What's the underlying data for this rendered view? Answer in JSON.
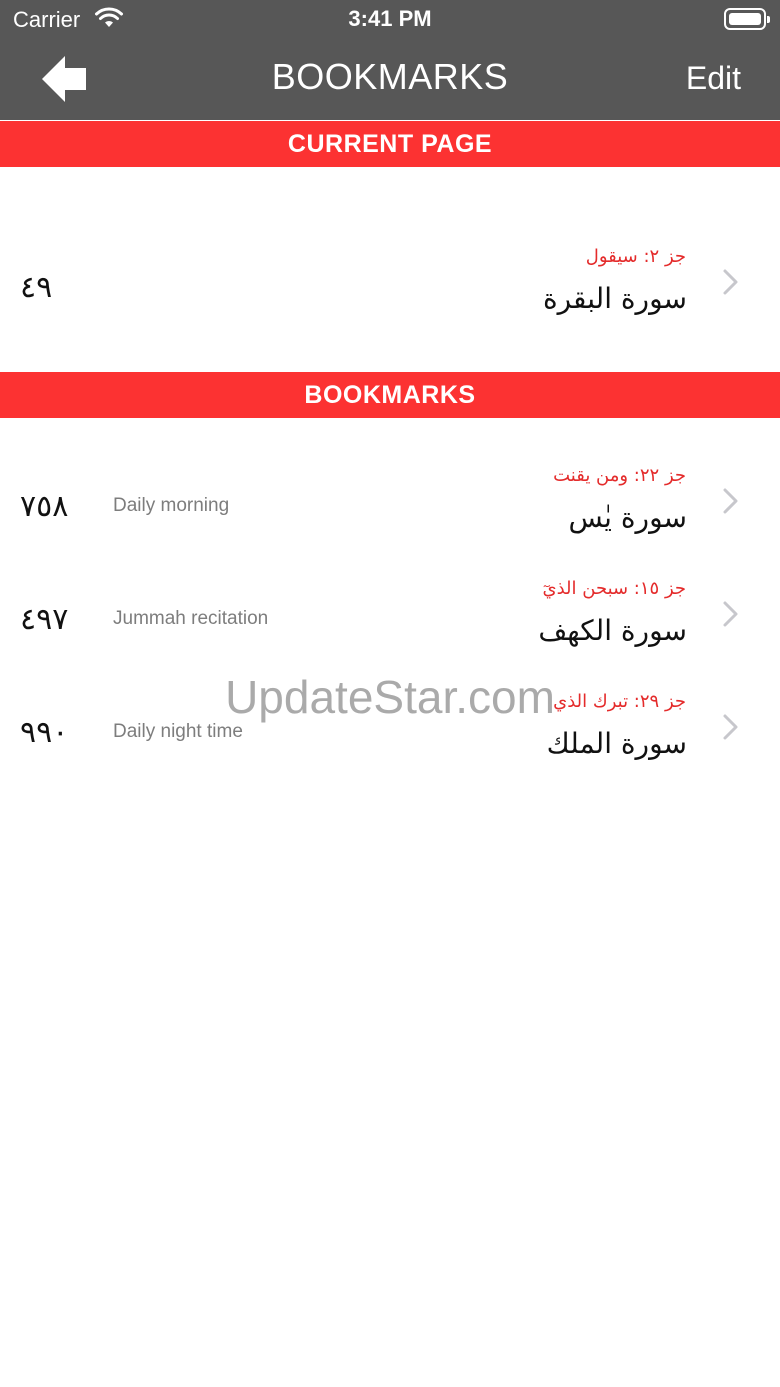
{
  "status_bar": {
    "carrier": "Carrier",
    "time": "3:41 PM"
  },
  "nav": {
    "title": "BOOKMARKS",
    "edit_label": "Edit"
  },
  "sections": {
    "current_page": "CURRENT PAGE",
    "bookmarks": "BOOKMARKS"
  },
  "current": {
    "page": "٤٩",
    "juz": "جز ٢: سيقول",
    "surah": "سورة البقرة"
  },
  "bookmarks": [
    {
      "page": "٧٥٨",
      "note": "Daily morning",
      "juz": "جز ٢٢: ومن يقنت",
      "surah": "سورة يٰس"
    },
    {
      "page": "٤٩٧",
      "note": "Jummah recitation",
      "juz": "جز ١٥: سبحن الذيٓ",
      "surah": "سورة الكهف"
    },
    {
      "page": "٩٩٠",
      "note": "Daily night time",
      "juz": "جز ٢٩: تبرك الذي",
      "surah": "سورة الملك"
    }
  ],
  "watermark": "UpdateStar.com",
  "colors": {
    "header_bar": "#575757",
    "section": "#fc3232",
    "juz_text": "#e42b2b",
    "note_text": "#7d7d7d"
  }
}
